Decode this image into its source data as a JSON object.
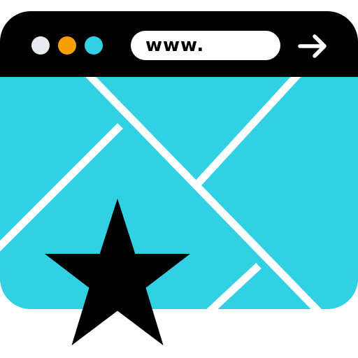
{
  "window_controls": [
    {
      "name": "window-dot-gray",
      "color": "#e7eaf0"
    },
    {
      "name": "window-dot-orange",
      "color": "#f5a003"
    },
    {
      "name": "window-dot-cyan",
      "color": "#31d0e3"
    }
  ],
  "address_bar": {
    "value": "www."
  },
  "go_button": {
    "icon": "arrow-right-icon"
  },
  "content": {
    "icon": "map-icon",
    "background_color": "#31d0e3",
    "road_color": "#ffffff"
  },
  "badge": {
    "icon": "star-icon",
    "color": "#000000"
  }
}
